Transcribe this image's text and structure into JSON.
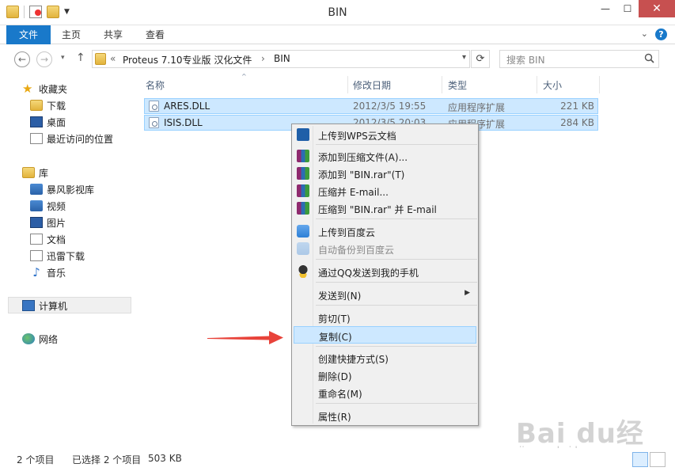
{
  "window": {
    "title": "BIN",
    "controls": {
      "minimize": "—",
      "maximize": "☐",
      "close": "✕"
    },
    "qat_icons": [
      "folder-icon",
      "properties-icon",
      "new-folder-icon",
      "customize-dropdown-icon"
    ]
  },
  "ribbon": {
    "tabs": [
      {
        "label": "文件",
        "active": true
      },
      {
        "label": "主页"
      },
      {
        "label": "共享"
      },
      {
        "label": "查看"
      }
    ],
    "expand_icon": "chevron-down-icon",
    "help_icon": "help-icon",
    "help_glyph": "?"
  },
  "address": {
    "back_glyph": "←",
    "forward_glyph": "→",
    "history_glyph": "▾",
    "up_glyph": "↑",
    "prefix": "«",
    "crumbs": [
      "Proteus  7.10专业版 汉化文件",
      "BIN"
    ],
    "crumb_sep": "›",
    "dropdown_glyph": "▾",
    "refresh_glyph": "⟳"
  },
  "search": {
    "placeholder": "搜索 BIN"
  },
  "nav": {
    "favorites": {
      "label": "收藏夹",
      "icon": "star-icon",
      "items": [
        {
          "label": "下载",
          "icon": "download-folder-icon"
        },
        {
          "label": "桌面",
          "icon": "desktop-icon"
        },
        {
          "label": "最近访问的位置",
          "icon": "recent-places-icon"
        }
      ]
    },
    "libraries": {
      "label": "库",
      "icon": "library-icon",
      "items": [
        {
          "label": "暴风影视库",
          "icon": "video-library-icon"
        },
        {
          "label": "视频",
          "icon": "videos-icon"
        },
        {
          "label": "图片",
          "icon": "pictures-icon"
        },
        {
          "label": "文档",
          "icon": "documents-icon"
        },
        {
          "label": "迅雷下载",
          "icon": "thunder-download-icon"
        },
        {
          "label": "音乐",
          "icon": "music-icon"
        }
      ]
    },
    "computer": {
      "label": "计算机",
      "icon": "computer-icon",
      "selected": true
    },
    "network": {
      "label": "网络",
      "icon": "network-icon"
    }
  },
  "files": {
    "columns": {
      "name": "名称",
      "date": "修改日期",
      "type": "类型",
      "size": "大小"
    },
    "sort_indicator": "^",
    "rows": [
      {
        "name": "ARES.DLL",
        "date": "2012/3/5 19:55",
        "type": "应用程序扩展",
        "size": "221 KB",
        "selected": true
      },
      {
        "name": "ISIS.DLL",
        "date": "2012/3/5 20:03",
        "type": "应用程序扩展",
        "size": "284 KB",
        "selected": true
      }
    ]
  },
  "context_menu": {
    "items": [
      {
        "label": "上传到WPS云文档",
        "icon": "wps-cloud-icon"
      },
      {
        "label": "添加到压缩文件(A)...",
        "icon": "winrar-icon"
      },
      {
        "label": "添加到 \"BIN.rar\"(T)",
        "icon": "winrar-icon"
      },
      {
        "label": "压缩并 E-mail...",
        "icon": "winrar-icon"
      },
      {
        "label": "压缩到 \"BIN.rar\" 并 E-mail",
        "icon": "winrar-icon"
      },
      {
        "label": "上传到百度云",
        "icon": "baidu-cloud-icon"
      },
      {
        "label": "自动备份到百度云",
        "icon": "baidu-cloud-icon",
        "disabled": true
      },
      {
        "label": "通过QQ发送到我的手机",
        "icon": "qq-penguin-icon"
      },
      {
        "label": "发送到(N)",
        "submenu": true,
        "submenu_glyph": "▶"
      },
      {
        "label": "剪切(T)"
      },
      {
        "label": "复制(C)",
        "highlighted": true
      },
      {
        "label": "创建快捷方式(S)"
      },
      {
        "label": "删除(D)"
      },
      {
        "label": "重命名(M)"
      },
      {
        "label": "属性(R)"
      }
    ]
  },
  "status": {
    "item_count": "2 个项目",
    "selection": "已选择 2 个项目",
    "selection_size": "503 KB",
    "view_buttons": [
      "details-view-icon",
      "large-icons-view-icon"
    ]
  },
  "annotation": {
    "arrow_color": "#e8433a",
    "arrow_icon": "red-arrow-icon"
  },
  "watermark": {
    "logo": "Bai du经验",
    "url": "jingyan.baidu.com"
  },
  "colors": {
    "accent": "#1979ca",
    "selection_fill": "#cde8ff",
    "selection_border": "#99d1ff",
    "close_button": "#c75050"
  }
}
